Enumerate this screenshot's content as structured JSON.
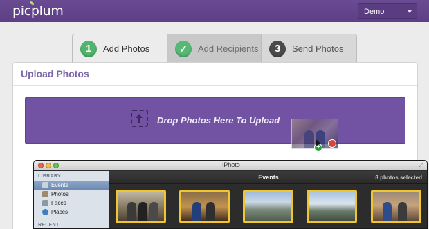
{
  "header": {
    "logo": "picplum",
    "account_select": "Demo"
  },
  "steps": [
    {
      "number": "1",
      "label": "Add Photos",
      "state": "active"
    },
    {
      "number": "✓",
      "label": "Add Recipients",
      "state": "complete"
    },
    {
      "number": "3",
      "label": "Send Photos",
      "state": "pending"
    }
  ],
  "upload": {
    "title": "Upload Photos",
    "dropzone_text": "Drop Photos Here To Upload",
    "drag_badge_count": "8"
  },
  "iphoto": {
    "window_title": "iPhoto",
    "toolbar_title": "Events",
    "selection_status": "8 photos selected",
    "sidebar": {
      "library_heading": "LIBRARY",
      "items": [
        {
          "label": "Events",
          "icon": "events-icon",
          "selected": true
        },
        {
          "label": "Photos",
          "icon": "photos-icon",
          "selected": false
        },
        {
          "label": "Faces",
          "icon": "faces-icon",
          "selected": false
        },
        {
          "label": "Places",
          "icon": "globe-icon",
          "selected": false
        }
      ],
      "recent_heading": "RECENT"
    }
  },
  "colors": {
    "brand_purple": "#5c3f84",
    "dropzone_purple": "#7253a3",
    "step_green": "#4fb56a",
    "selection_yellow": "#f0c532"
  }
}
